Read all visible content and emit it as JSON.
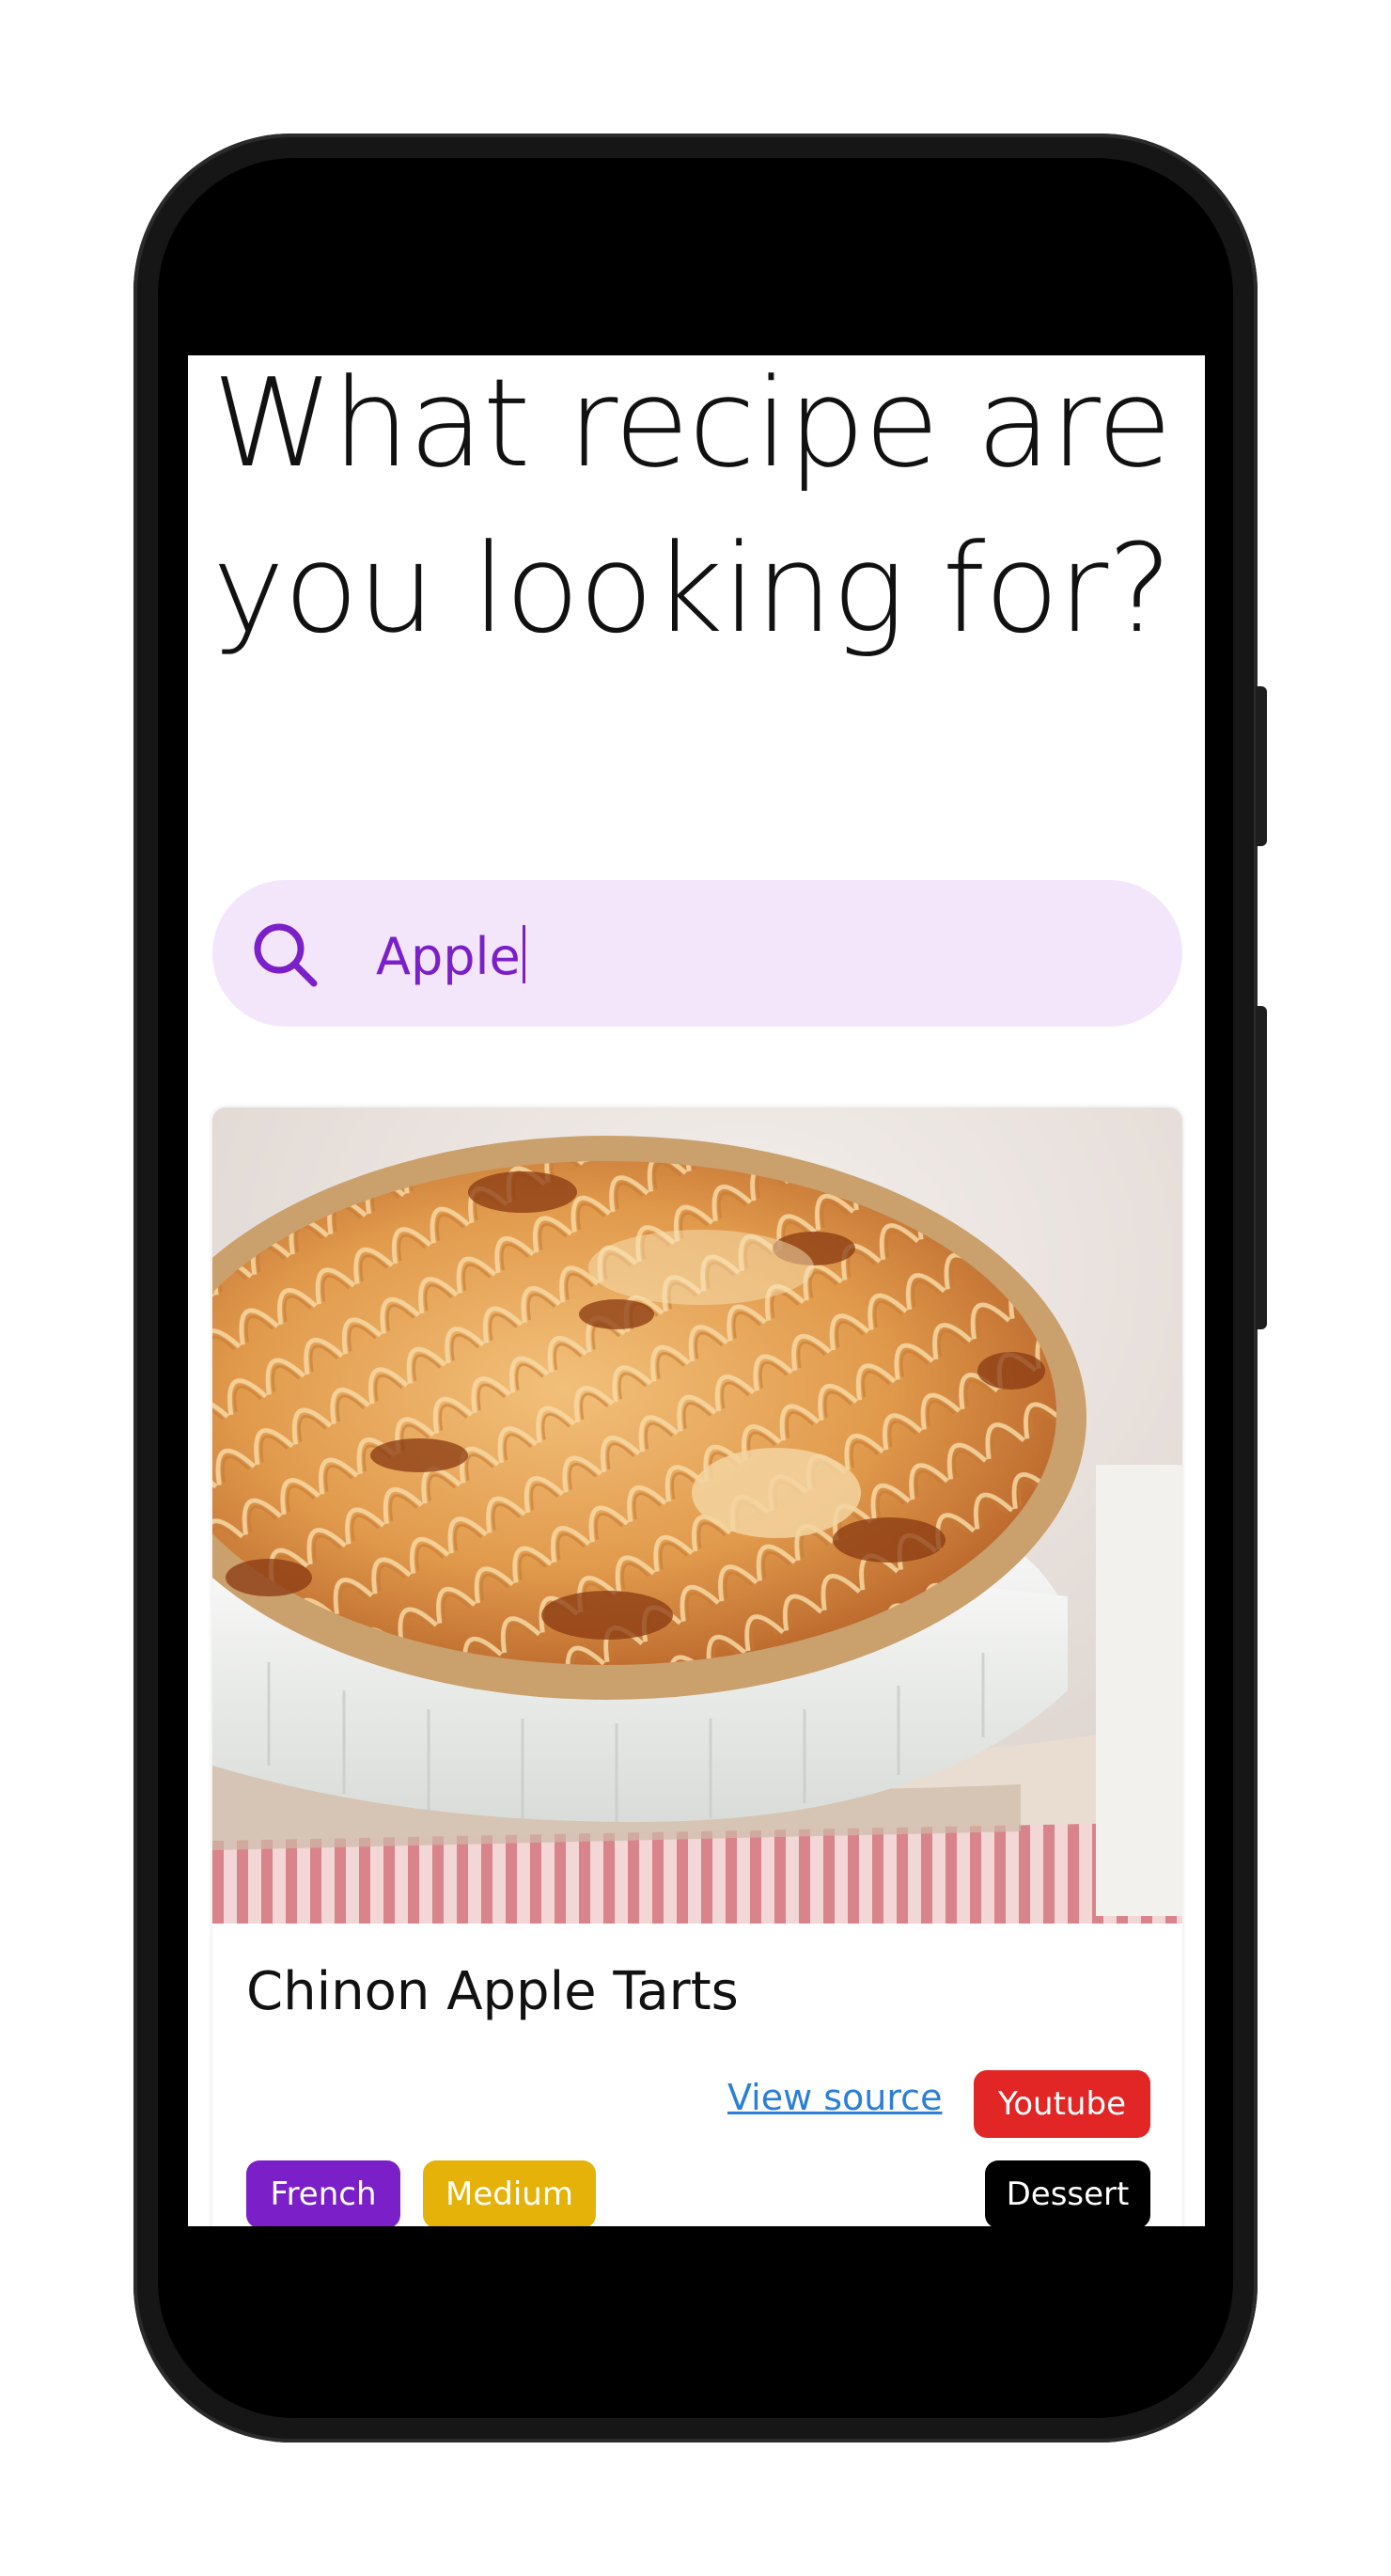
{
  "headline": "What recipe are you looking for?",
  "search": {
    "value": "Apple",
    "icon": "search-icon"
  },
  "recipe": {
    "title": "Chinon Apple Tarts",
    "image_alt": "apple tart",
    "view_source_label": "View source",
    "source_chip": "Youtube",
    "tags": {
      "cuisine": "French",
      "difficulty": "Medium",
      "category": "Dessert"
    }
  },
  "colors": {
    "accent": "#7b1fc9",
    "search_bg": "#f3e6fb",
    "youtube": "#e12625",
    "medium": "#e4b208",
    "dessert": "#000000",
    "link": "#2b7fd6"
  }
}
